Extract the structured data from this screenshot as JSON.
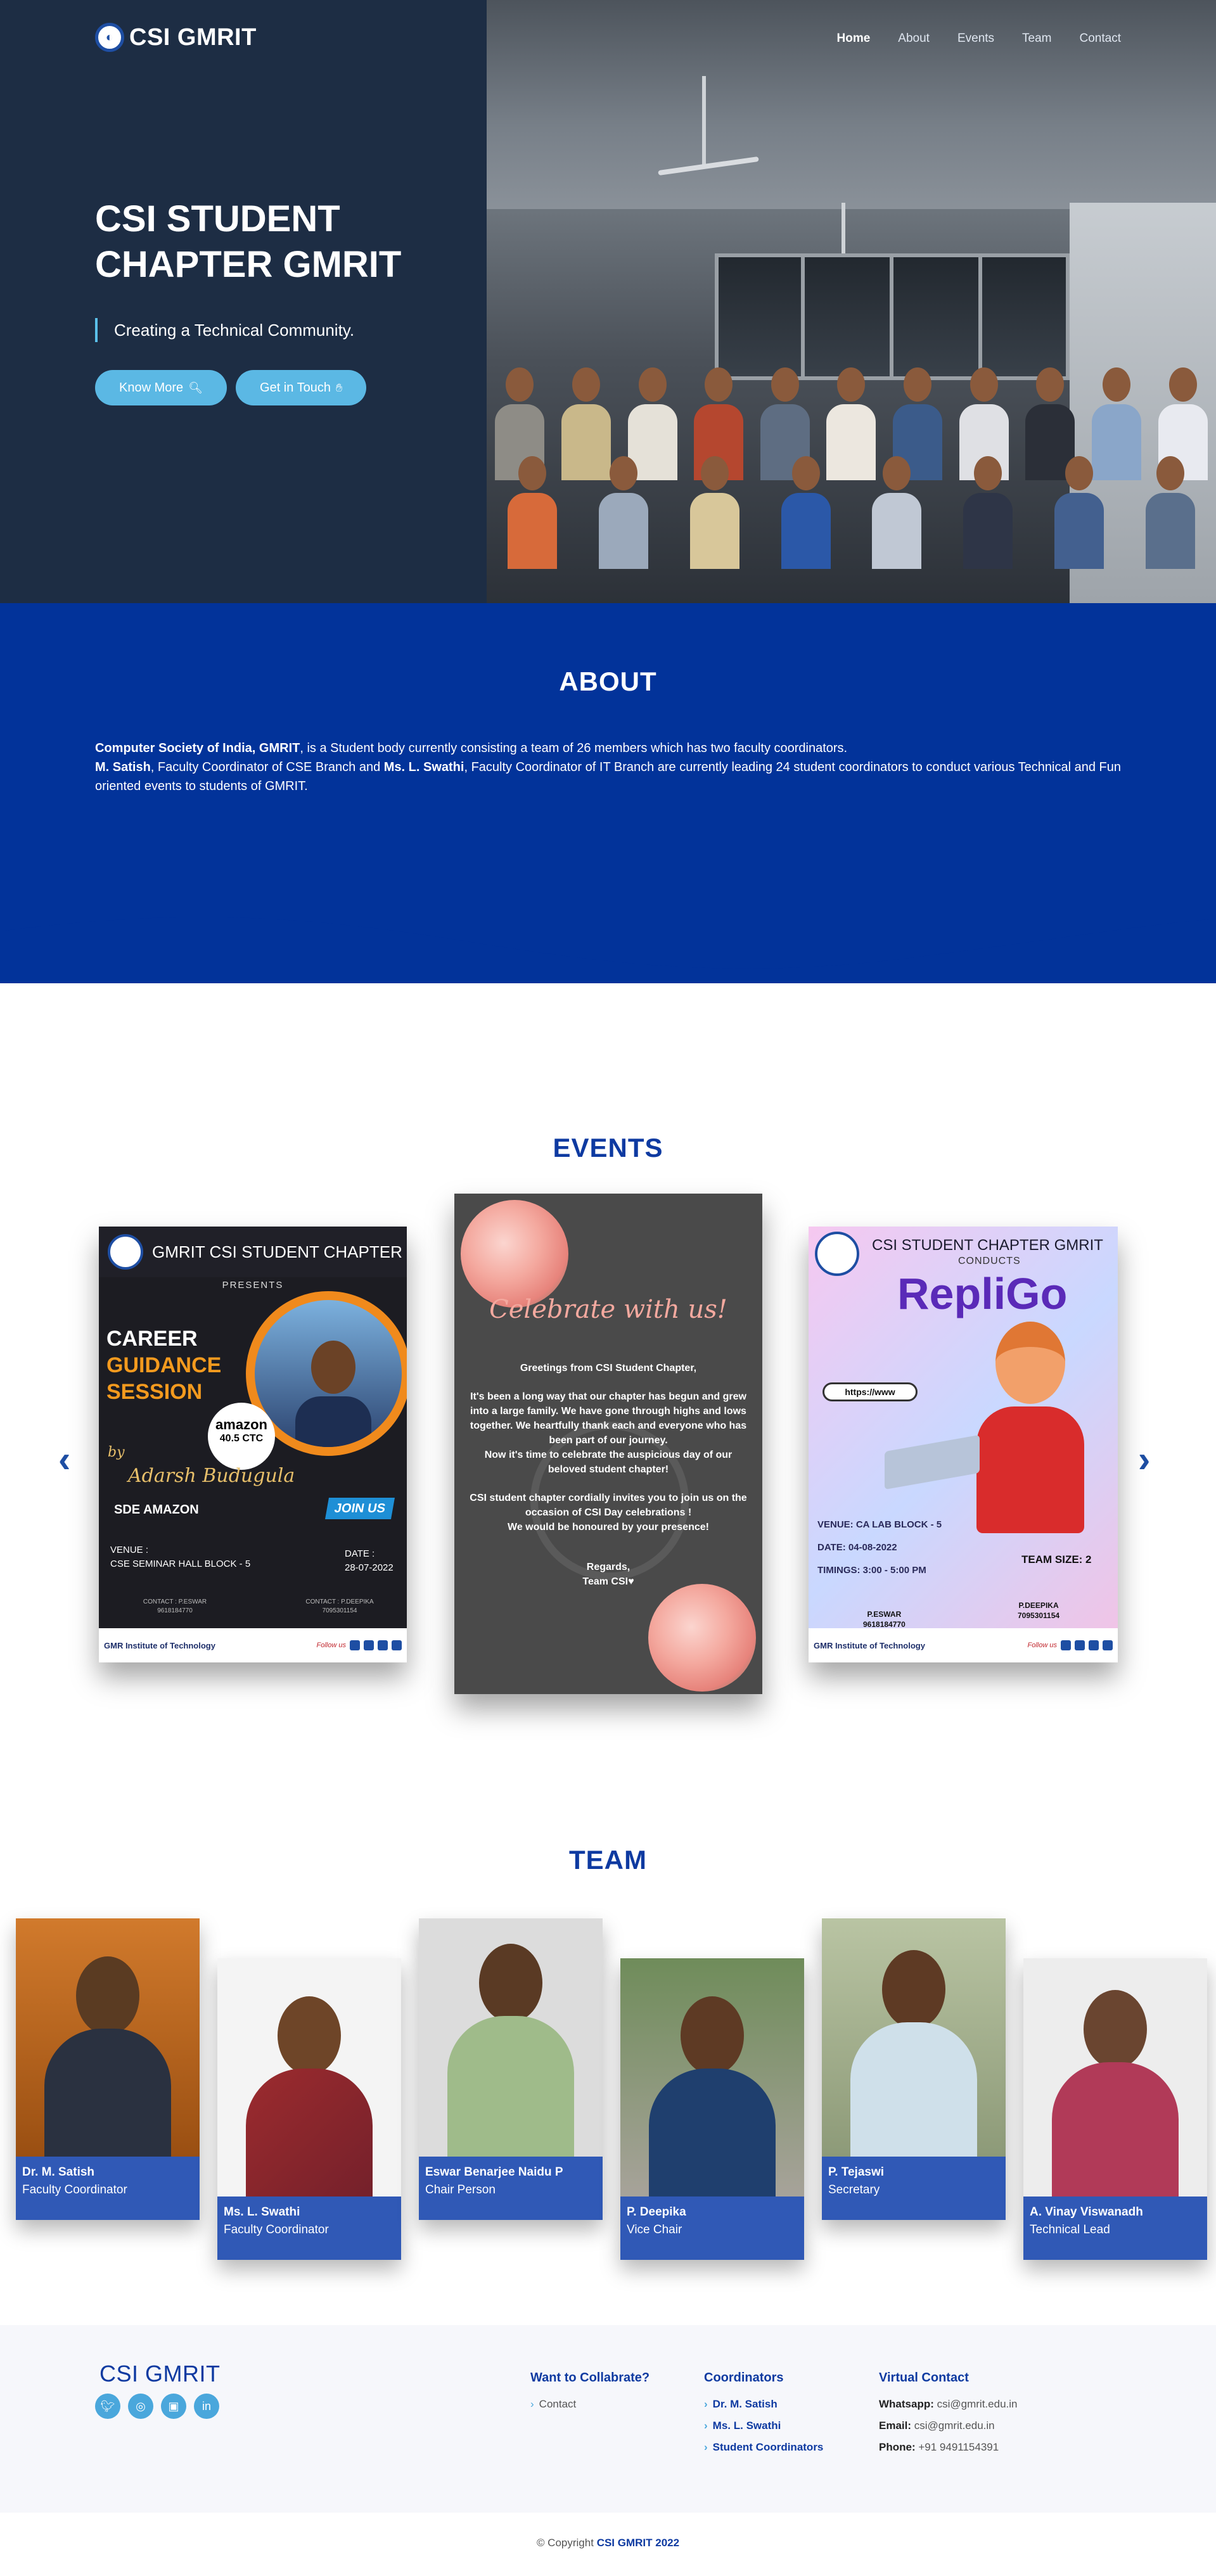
{
  "brand": {
    "name": "CSI GMRIT"
  },
  "nav": [
    {
      "label": "Home",
      "active": true
    },
    {
      "label": "About",
      "active": false
    },
    {
      "label": "Events",
      "active": false
    },
    {
      "label": "Team",
      "active": false
    },
    {
      "label": "Contact",
      "active": false
    }
  ],
  "hero": {
    "title_line1": "CSI STUDENT",
    "title_line2": "CHAPTER GMRIT",
    "subtitle": "Creating a Technical Community.",
    "btn_know_more": "Know More",
    "btn_get_in_touch": "Get in Touch"
  },
  "about": {
    "title": "ABOUT",
    "p1_bold": "Computer Society of India, GMRIT",
    "p1_rest": ", is a Student body currently consisting a team of 26 members which has two faculty coordinators.",
    "p2_bold1": "M. Satish",
    "p2_mid": ", Faculty Coordinator of CSE Branch and ",
    "p2_bold2": "Ms. L. Swathi",
    "p2_rest": ", Faculty Coordinator of IT Branch are currently leading 24 student coordinators to conduct various Technical and Fun oriented events to students of GMRIT."
  },
  "events": {
    "title": "EVENTS",
    "poster1": {
      "header": "GMRIT CSI STUDENT CHAPTER",
      "presents": "PRESENTS",
      "career1": "CAREER",
      "career2": "GUIDANCE",
      "career3": "SESSION",
      "badge_brand": "amazon",
      "badge_ctc": "40.5 CTC",
      "by": "by",
      "speaker": "Adarsh Budugula",
      "role": "SDE AMAZON",
      "join": "JOIN US",
      "venue_label": "VENUE :",
      "venue": "CSE SEMINAR HALL BLOCK - 5",
      "date_label": "DATE :",
      "date": "28-07-2022",
      "contact1": "CONTACT : P.ESWAR\n9618184770",
      "contact2": "CONTACT : P.DEEPIKA\n7095301154",
      "strip_left": "GMR Institute of Technology",
      "strip_follow": "Follow us"
    },
    "poster2": {
      "celebrate": "Celebrate with us!",
      "p1": "Greetings from CSI Student Chapter,",
      "p2": "It's been a long way that our chapter has begun and grew into a large family. We have gone through highs and lows together. We heartfully thank each and everyone who has been part of our journey.",
      "p3": "Now it's time to celebrate the auspicious day of our beloved student chapter!",
      "p4": "CSI student chapter cordially invites you to join us on the occasion of CSI Day celebrations !",
      "p5": "We would be honoured by your presence!",
      "p6": "Regards,",
      "p7": "Team CSI♥"
    },
    "poster3": {
      "header": "CSI STUDENT CHAPTER GMRIT",
      "conducts": "CONDUCTS",
      "title": "RepliGo",
      "url": "https://www",
      "venue": "VENUE: CA LAB BLOCK - 5",
      "date": "DATE: 04-08-2022",
      "timings": "TIMINGS: 3:00 - 5:00 PM",
      "team_size": "TEAM SIZE: 2",
      "contact1": "P.ESWAR\n9618184770",
      "contact2": "P.DEEPIKA\n7095301154",
      "strip_left": "GMR Institute of Technology",
      "strip_follow": "Follow us"
    }
  },
  "team": {
    "title": "TEAM",
    "members": [
      {
        "name": "Dr. M. Satish",
        "role": "Faculty Coordinator"
      },
      {
        "name": "Ms. L. Swathi",
        "role": "Faculty Coordinator"
      },
      {
        "name": "Eswar Benarjee Naidu P",
        "role": "Chair Person"
      },
      {
        "name": "P. Deepika",
        "role": "Vice Chair"
      },
      {
        "name": "P. Tejaswi",
        "role": "Secretary"
      },
      {
        "name": "A. Vinay Viswanadh",
        "role": "Technical Lead"
      }
    ]
  },
  "footer": {
    "brand": "CSI GMRIT",
    "collab_title": "Want to Collabrate?",
    "collab_items": [
      "Contact"
    ],
    "coord_title": "Coordinators",
    "coord_items": [
      "Dr. M. Satish",
      "Ms. L. Swathi",
      "Student Coordinators"
    ],
    "contact_title": "Virtual Contact",
    "whatsapp_label": "Whatsapp:",
    "whatsapp": "csi@gmrit.edu.in",
    "email_label": "Email:",
    "email": "csi@gmrit.edu.in",
    "phone_label": "Phone:",
    "phone": "+91 9491154391",
    "copyright_prefix": "© Copyright",
    "copyright_brand": "CSI GMRIT 2022"
  },
  "colors": {
    "hero_bg": "#1d2d44",
    "about_bg": "#02339a",
    "accent": "#5bb8e4",
    "title_blue": "#0e3aa1",
    "caption_blue": "#3059b6"
  }
}
